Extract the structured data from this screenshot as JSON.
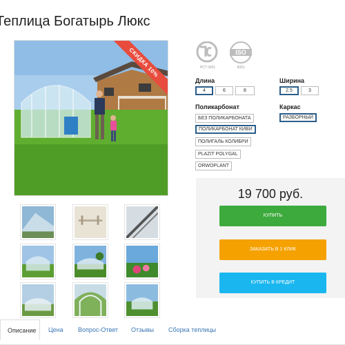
{
  "page": {
    "title": "Теплица Богатырь Люкс"
  },
  "gallery": {
    "sale_badge": "СКИДКА 10%"
  },
  "certificates": {
    "rst_caption": "РСТ 0001",
    "iso_caption": "9001",
    "iso_text": "ISO"
  },
  "options": {
    "length": {
      "label": "Длина",
      "values": [
        "4",
        "6",
        "8"
      ],
      "selected": "4"
    },
    "width": {
      "label": "Ширина",
      "values": [
        "2.5",
        "3"
      ],
      "selected": "2.5"
    },
    "polycarbonate": {
      "label": "Поликарбонат",
      "values": [
        "БЕЗ ПОЛИКАРБОНАТА",
        "ПОЛИКАРБОНАТ КИВИ",
        "ПОЛИГАЛЬ КОЛИБРИ",
        "PLAZIT POLYGAL",
        "ORWOPLANT"
      ],
      "selected": "ПОЛИКАРБОНАТ КИВИ"
    },
    "frame": {
      "label": "Каркас",
      "values": [
        "РАЗБОРНЫЙ"
      ],
      "selected": "РАЗБОРНЫЙ"
    }
  },
  "purchase": {
    "price": "19 700 руб.",
    "buy_label": "КУПИТЬ",
    "one_click_label": "ЗАКАЗАТЬ В 1 КЛИК",
    "credit_label": "КУПИТЬ В КРЕДИТ",
    "colors": {
      "buy": "#3caa3c",
      "one_click": "#f5a100",
      "credit": "#1ab6ef"
    }
  },
  "tabs": [
    {
      "label": "Описание",
      "active": true
    },
    {
      "label": "Цена"
    },
    {
      "label": "Вопрос-Ответ"
    },
    {
      "label": "Отзывы"
    },
    {
      "label": "Сборка теплицы"
    }
  ]
}
